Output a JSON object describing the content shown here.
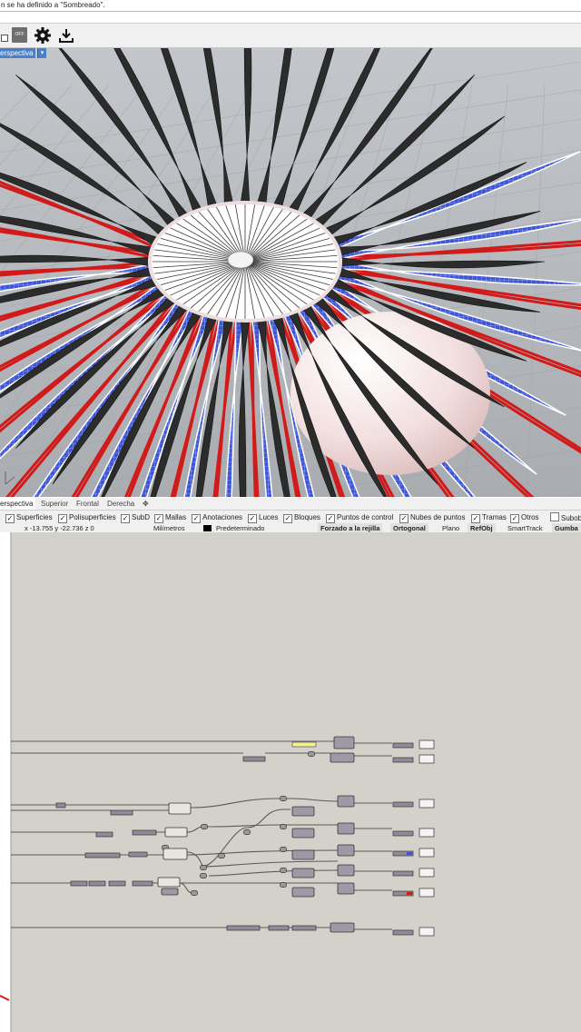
{
  "command_line": {
    "text": "n se ha definido a \"Sombreado\"."
  },
  "toolbar": {
    "off_label": "OFF",
    "icons": [
      "checkbox-icon",
      "gear-icon",
      "export-icon"
    ]
  },
  "viewport": {
    "title": "erspectiva",
    "menu_arrow": "▾"
  },
  "viewport_tabs": [
    {
      "label": "erspectiva",
      "active": true
    },
    {
      "label": "Superior",
      "active": false
    },
    {
      "label": "Frontal",
      "active": false
    },
    {
      "label": "Derecha",
      "active": false
    },
    {
      "label": "✥",
      "active": false
    }
  ],
  "osnap_filters": [
    {
      "label": "Superficies",
      "checked": true
    },
    {
      "label": "Polisuperficies",
      "checked": true
    },
    {
      "label": "SubD",
      "checked": true
    },
    {
      "label": "Mallas",
      "checked": true
    },
    {
      "label": "Anotaciones",
      "checked": true
    },
    {
      "label": "Luces",
      "checked": true
    },
    {
      "label": "Bloques",
      "checked": true
    },
    {
      "label": "Puntos de control",
      "checked": true
    },
    {
      "label": "Nubes de puntos",
      "checked": true
    },
    {
      "label": "Tramas",
      "checked": true
    },
    {
      "label": "Otros",
      "checked": true
    },
    {
      "label": "Subob",
      "checked": false
    }
  ],
  "status_bar": {
    "coordinates": "x -13.755  y -22.736  z 0",
    "units": "Milímetros",
    "layer": "Predeterminado",
    "grid_snap": "Forzado a la rejilla",
    "ortho": "Ortogonal",
    "planar": "Plano",
    "osnap": "RefObj",
    "smarttrack": "SmartTrack",
    "gumball": "Gumba"
  },
  "colors": {
    "viewport_bg": "#b9bcc0",
    "blade_dark": "#2c2c2c",
    "blade_red": "#d11a1a",
    "blade_blue": "#3f57d6",
    "canvas_bg": "#d4d1ca",
    "viewport_title_bg": "#4a7fc9"
  }
}
